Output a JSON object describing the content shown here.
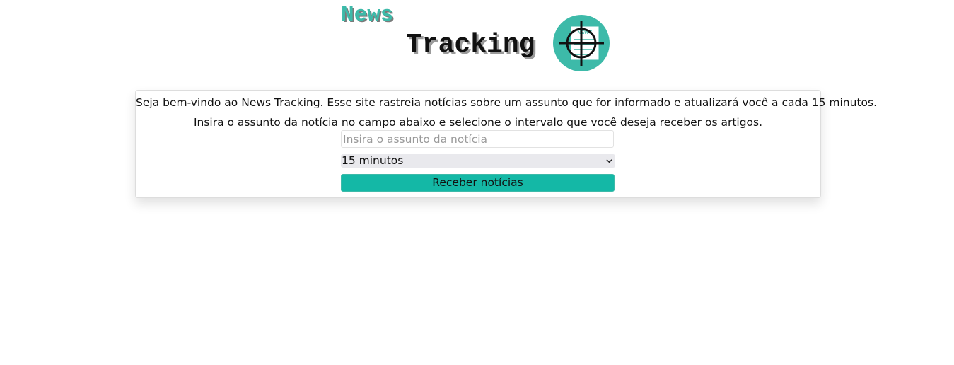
{
  "header": {
    "logo_word_1": "News",
    "logo_word_2": "Tracking",
    "badge_text": "NEWS",
    "colors": {
      "accent": "#3dbaa9",
      "button": "#14b8a6"
    }
  },
  "main": {
    "intro_line_1": "Seja bem-vindo ao News Tracking. Esse site rastreia notícias sobre um assunto que for informado e atualizará você a cada 15 minutos.",
    "intro_line_2": "Insira o assunto da notícia no campo abaixo e selecione o intervalo que você deseja receber os artigos.",
    "topic_input": {
      "value": "",
      "placeholder": "Insira o assunto da notícia"
    },
    "interval_select": {
      "selected": "15 minutos",
      "icon": "chevron-down-icon"
    },
    "submit_label": "Receber notícias"
  }
}
